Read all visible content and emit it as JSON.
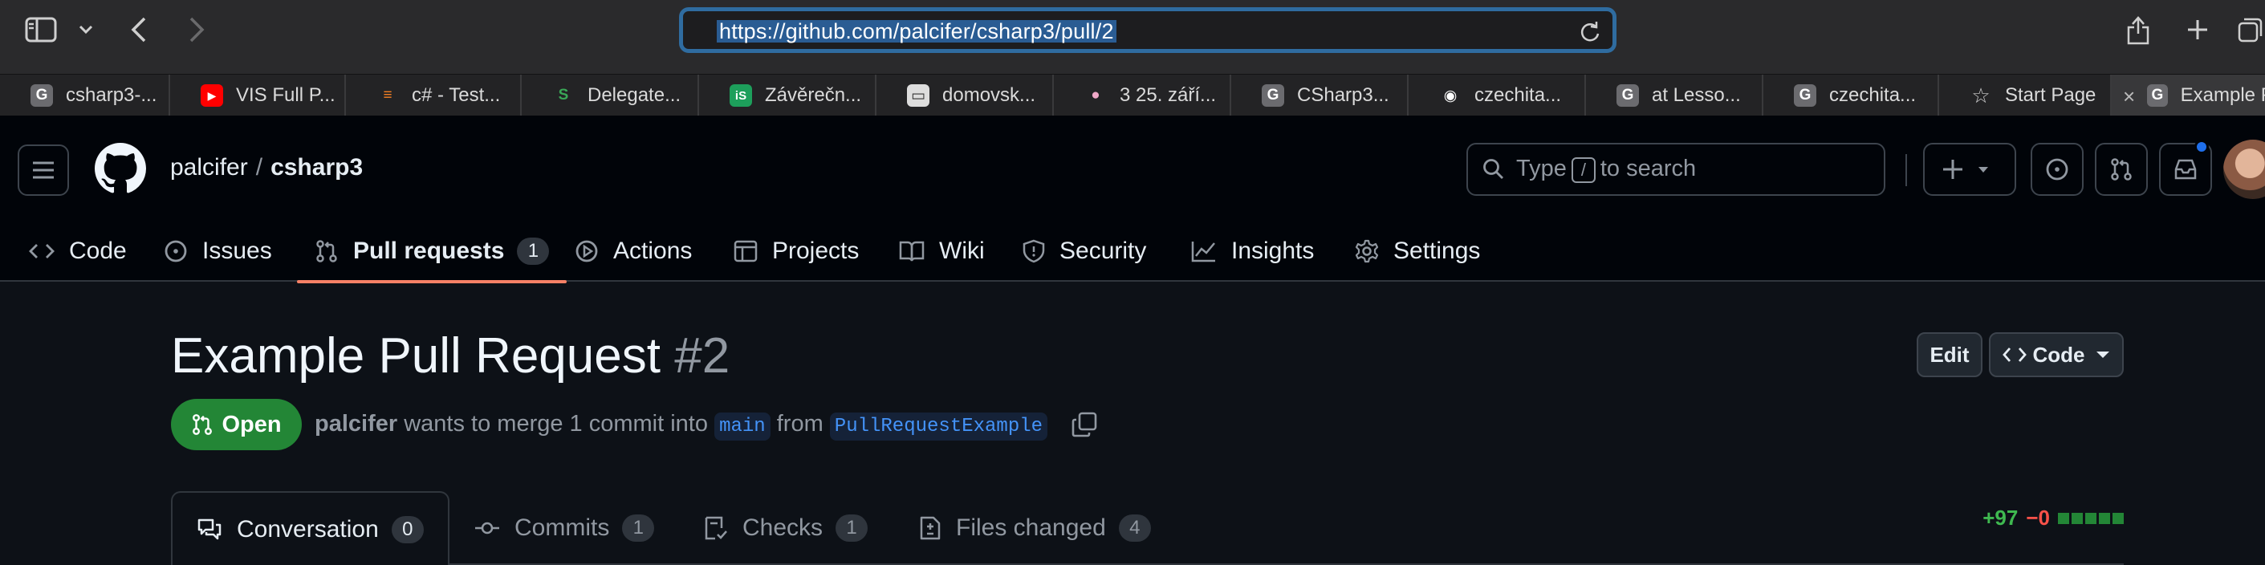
{
  "browser": {
    "url": "https://github.com/palcifer/csharp3/pull/2",
    "tabs": [
      {
        "label": "csharp3-...",
        "favicon": "G",
        "color": "#6b6b6f"
      },
      {
        "label": "VIS Full P...",
        "favicon": "▶",
        "color": "#ff0000"
      },
      {
        "label": "c# - Test...",
        "favicon": "≡",
        "color": "#f48024"
      },
      {
        "label": "Delegate...",
        "favicon": "S",
        "color": "#3aa757"
      },
      {
        "label": "Závěrečn...",
        "favicon": "iS",
        "color": "#1d9f5b"
      },
      {
        "label": "domovsk...",
        "favicon": "▭",
        "color": "#dddddd"
      },
      {
        "label": "3 25. září...",
        "favicon": "●",
        "color": "#f0a8c8"
      },
      {
        "label": "CSharp3...",
        "favicon": "G",
        "color": "#6b6b6f"
      },
      {
        "label": "czechita...",
        "favicon": "◉",
        "color": "#ffffff"
      },
      {
        "label": "at Lesso...",
        "favicon": "G",
        "color": "#6b6b6f"
      },
      {
        "label": "czechita...",
        "favicon": "G",
        "color": "#6b6b6f"
      },
      {
        "label": "Start Page",
        "favicon": "☆",
        "color": "#2a2a2c"
      },
      {
        "label": "Example P",
        "favicon": "G",
        "color": "#6b6b6f"
      }
    ]
  },
  "github": {
    "owner": "palcifer",
    "separator": "/",
    "repo": "csharp3",
    "search_placeholder_before": "Type",
    "search_key": "/",
    "search_placeholder_after": "to search",
    "nav": {
      "code": "Code",
      "issues": "Issues",
      "pull_requests": "Pull requests",
      "pull_requests_count": "1",
      "actions": "Actions",
      "projects": "Projects",
      "wiki": "Wiki",
      "security": "Security",
      "insights": "Insights",
      "settings": "Settings"
    }
  },
  "pr": {
    "title": "Example Pull Request",
    "number": "#2",
    "edit_label": "Edit",
    "code_label": "Code",
    "state": "Open",
    "author": "palcifer",
    "merge_text_1": "wants to merge 1 commit into",
    "base_branch": "main",
    "merge_text_2": "from",
    "head_branch": "PullRequestExample",
    "tabs": {
      "conversation": "Conversation",
      "conversation_count": "0",
      "commits": "Commits",
      "commits_count": "1",
      "checks": "Checks",
      "checks_count": "1",
      "files": "Files changed",
      "files_count": "4"
    },
    "additions": "+97",
    "deletions": "−0"
  }
}
